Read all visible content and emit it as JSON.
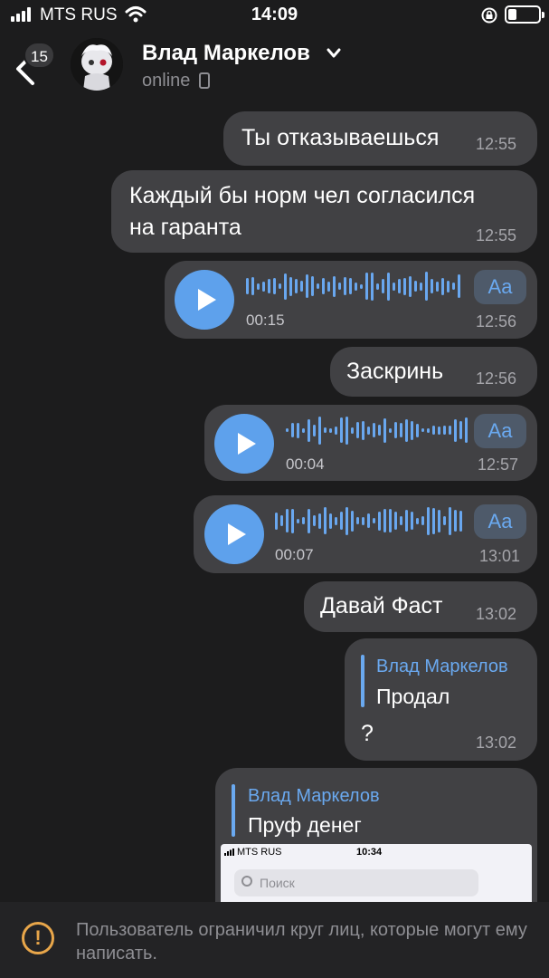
{
  "status_bar": {
    "carrier": "MTS RUS",
    "time": "14:09",
    "icons": [
      "signal-icon",
      "wifi-icon",
      "rotation-lock-icon",
      "battery-icon"
    ]
  },
  "header": {
    "back_badge": "15",
    "contact_name": "Влад Маркелов",
    "presence": "online"
  },
  "messages": [
    {
      "kind": "text",
      "text": "Ты отказываешься",
      "time": "12:55"
    },
    {
      "kind": "text",
      "text": "Каждый бы норм чел согласился",
      "text2": "на гаранта",
      "time": "12:55"
    },
    {
      "kind": "voice",
      "duration": "00:15",
      "time": "12:56",
      "transcribe": "Aa"
    },
    {
      "kind": "text",
      "text": "Заскринь",
      "time": "12:56"
    },
    {
      "kind": "voice",
      "duration": "00:04",
      "time": "12:57",
      "transcribe": "Aa"
    },
    {
      "kind": "voice",
      "duration": "00:07",
      "time": "13:01",
      "transcribe": "Aa"
    },
    {
      "kind": "text",
      "text": "Давай Фаст",
      "time": "13:02"
    },
    {
      "kind": "reply",
      "reply_name": "Влад Маркелов",
      "reply_text": "Продал",
      "text": "?",
      "time": "13:02"
    },
    {
      "kind": "reply_image",
      "reply_name": "Влад Маркелов",
      "reply_text": "Пруф денег",
      "image": {
        "carrier": "MTS RUS",
        "time": "10:34",
        "search_placeholder": "Поиск"
      }
    }
  ],
  "colors": {
    "background": "#1c1c1d",
    "bubble": "#414144",
    "accent": "#5ea1ec",
    "warning": "#e8a64a"
  },
  "restricted_notice": {
    "icon": "warning-icon",
    "text": "Пользователь ограничил круг лиц, которые могут ему написать."
  }
}
